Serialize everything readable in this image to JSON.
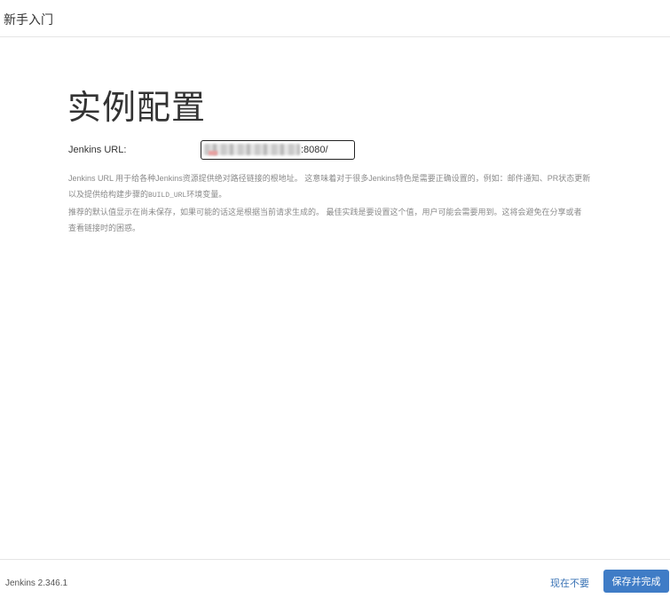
{
  "header": {
    "title": "新手入门"
  },
  "main": {
    "title": "实例配置",
    "url_label": "Jenkins URL:",
    "url_value_visible": ":8080/",
    "help_line1": "Jenkins URL 用于给各种Jenkins资源提供绝对路径链接的根地址。 这意味着对于很多Jenkins特色是需要正确设置的，例如：邮件通知、PR状态更新",
    "help_line2_prefix": "以及提供给构建步骤的",
    "help_line2_code": "BUILD_URL",
    "help_line2_suffix": "环境变量。",
    "help_line3": "推荐的默认值显示在尚未保存，如果可能的话这是根据当前请求生成的。 最佳实践是要设置这个值，用户可能会需要用到。这将会避免在分享或者",
    "help_line4": "查看链接时的困惑。"
  },
  "footer": {
    "version": "Jenkins 2.346.1",
    "skip_label": "现在不要",
    "save_label": "保存并完成"
  },
  "colors": {
    "primary": "#3f7cc6",
    "link": "#3a73b5"
  }
}
